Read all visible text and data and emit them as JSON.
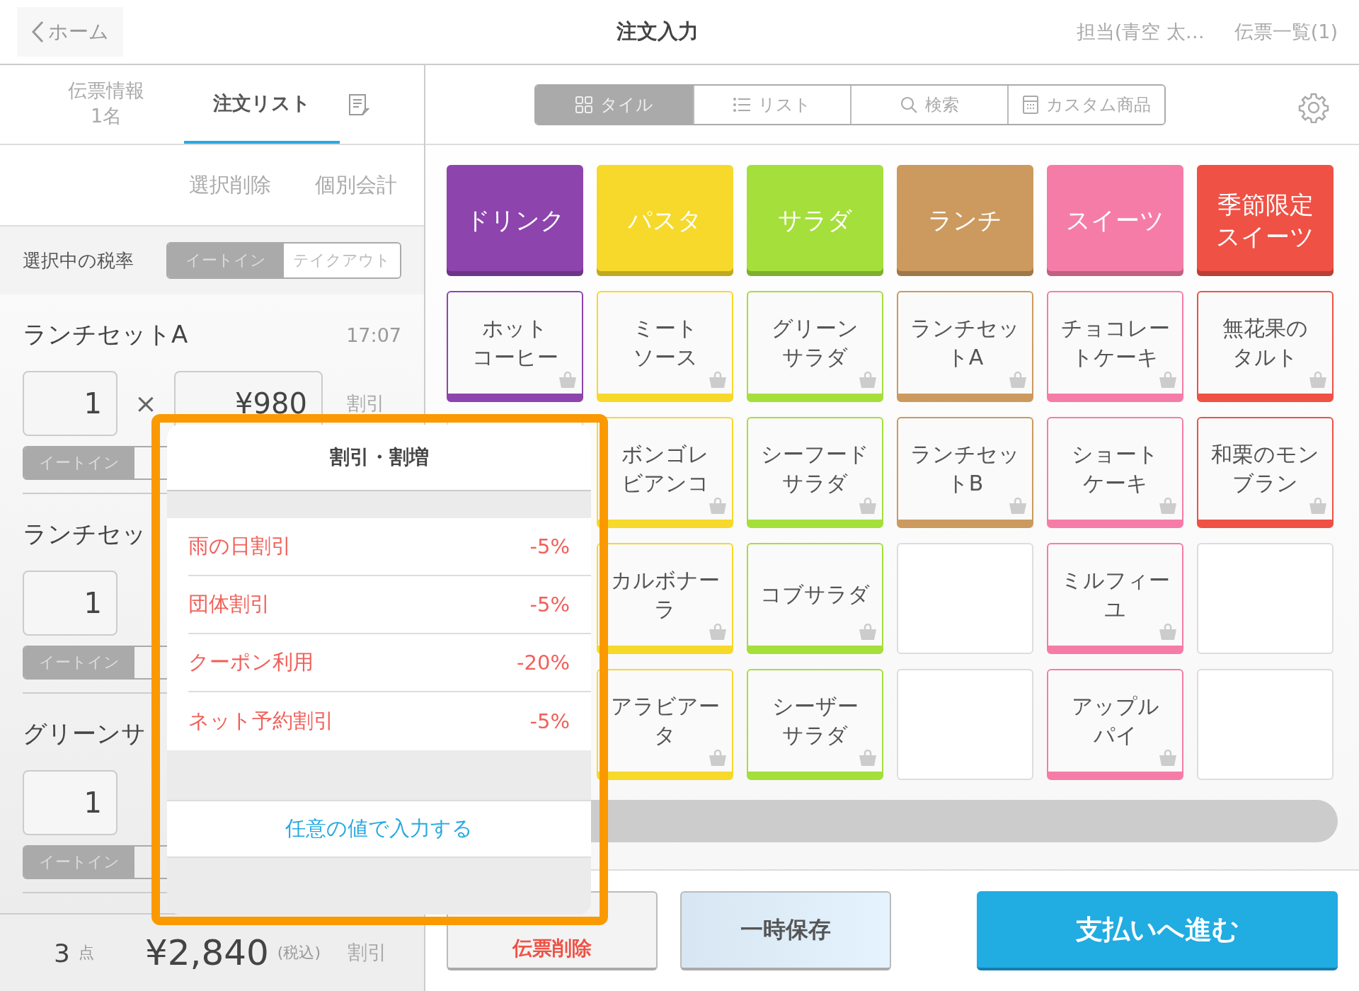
{
  "header": {
    "back": "ホーム",
    "title": "注文入力",
    "staff": "担当(青空 太…",
    "slips": "伝票一覧(1)"
  },
  "left_tabs": [
    {
      "lines": [
        "伝票情報",
        "1名"
      ],
      "selected": false
    },
    {
      "lines": [
        "注文リスト"
      ],
      "selected": true
    }
  ],
  "actions": [
    "選択削除",
    "個別会計"
  ],
  "tax_rate": {
    "label": "選択中の税率",
    "options": [
      {
        "label": "イートイン",
        "selected": true
      },
      {
        "label": "テイクアウト",
        "selected": false
      }
    ]
  },
  "items": [
    {
      "name": "ランチセットA",
      "time": "17:07",
      "qty": "1",
      "times": "×",
      "price": "¥980",
      "discount": "割引",
      "tax": "イートイン"
    },
    {
      "name": "ランチセッ",
      "qty": "1",
      "tax": "イートイン"
    },
    {
      "name": "グリーンサ",
      "qty": "1",
      "tax": "イートイン"
    }
  ],
  "summary": {
    "count": "3",
    "count_unit": "点",
    "total": "¥2,840",
    "tax_note": "(税込)",
    "discount": "割引"
  },
  "views": [
    {
      "kind": "grid",
      "label": "タイル",
      "selected": true
    },
    {
      "kind": "list",
      "label": "リスト",
      "selected": false
    },
    {
      "kind": "search",
      "label": "検索",
      "selected": false
    },
    {
      "kind": "calc",
      "label": "カスタム商品",
      "selected": false
    }
  ],
  "categories": [
    {
      "lines": [
        "ドリンク"
      ],
      "color": "#8d44ad"
    },
    {
      "lines": [
        "パスタ"
      ],
      "color": "#f6d92a"
    },
    {
      "lines": [
        "サラダ"
      ],
      "color": "#a5df3b"
    },
    {
      "lines": [
        "ランチ"
      ],
      "color": "#cc9a5e"
    },
    {
      "lines": [
        "スイーツ"
      ],
      "color": "#f67ca8"
    },
    {
      "lines": [
        "季節限定",
        "スイーツ"
      ],
      "color": "#ef5145"
    }
  ],
  "product_rows": [
    [
      {
        "kind": "product",
        "lines": [
          "ホット",
          "コーヒー"
        ],
        "color": "#8d44ad"
      },
      {
        "kind": "product",
        "lines": [
          "ミート",
          "ソース"
        ],
        "color": "#f6d92a"
      },
      {
        "kind": "product",
        "lines": [
          "グリーン",
          "サラダ"
        ],
        "color": "#a5df3b"
      },
      {
        "kind": "product",
        "lines": [
          "ランチセッ",
          "トA"
        ],
        "color": "#cc9a5e"
      },
      {
        "kind": "product",
        "lines": [
          "チョコレー",
          "トケーキ"
        ],
        "color": "#f67ca8"
      },
      {
        "kind": "product",
        "lines": [
          "無花果の",
          "タルト"
        ],
        "color": "#ef5145"
      }
    ],
    [
      {
        "kind": "empty"
      },
      {
        "kind": "product",
        "lines": [
          "ボンゴレ",
          "ビアンコ"
        ],
        "color": "#f6d92a"
      },
      {
        "kind": "product",
        "lines": [
          "シーフード",
          "サラダ"
        ],
        "color": "#a5df3b"
      },
      {
        "kind": "product",
        "lines": [
          "ランチセッ",
          "トB"
        ],
        "color": "#cc9a5e"
      },
      {
        "kind": "product",
        "lines": [
          "ショート",
          "ケーキ"
        ],
        "color": "#f67ca8"
      },
      {
        "kind": "product",
        "lines": [
          "和栗のモン",
          "ブラン"
        ],
        "color": "#ef5145"
      }
    ],
    [
      {
        "kind": "covered"
      },
      {
        "kind": "product",
        "lines": [
          "カルボナー",
          "ラ"
        ],
        "color": "#f6d92a"
      },
      {
        "kind": "product",
        "lines": [
          "コブサラダ"
        ],
        "color": "#a5df3b"
      },
      {
        "kind": "empty"
      },
      {
        "kind": "product",
        "lines": [
          "ミルフィー",
          "ユ"
        ],
        "color": "#f67ca8"
      },
      {
        "kind": "empty"
      }
    ],
    [
      {
        "kind": "covered"
      },
      {
        "kind": "product",
        "lines": [
          "アラビアー",
          "タ"
        ],
        "color": "#f6d92a"
      },
      {
        "kind": "product",
        "lines": [
          "シーザー",
          "サラダ"
        ],
        "color": "#a5df3b"
      },
      {
        "kind": "empty"
      },
      {
        "kind": "product",
        "lines": [
          "アップル",
          "パイ"
        ],
        "color": "#f67ca8"
      },
      {
        "kind": "empty"
      }
    ]
  ],
  "bottom_buttons": [
    {
      "kind": "danger",
      "label": "伝票削除"
    },
    {
      "kind": "secondary",
      "label": "一時保存"
    },
    {
      "kind": "primary",
      "label": "支払いへ進む"
    }
  ],
  "discount_popup": {
    "title": "割引・割増",
    "options": [
      {
        "name": "雨の日割引",
        "value": "-5%"
      },
      {
        "name": "団体割引",
        "value": "-5%"
      },
      {
        "name": "クーポン利用",
        "value": "-20%"
      },
      {
        "name": "ネット予約割引",
        "value": "-5%"
      }
    ],
    "custom": "任意の値で入力する"
  }
}
